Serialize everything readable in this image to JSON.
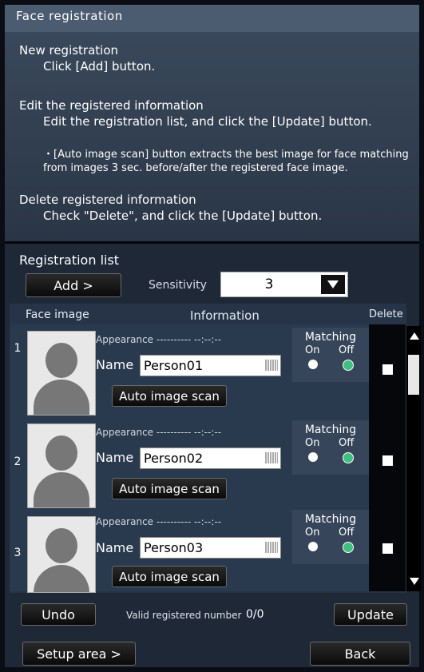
{
  "title": "Face registration",
  "instructions": {
    "new_heading": "New registration",
    "new_text": "Click [Add] button.",
    "edit_heading": "Edit the registered information",
    "edit_text": "Edit the registration list, and click the [Update] button.",
    "note_line1": "・[Auto image scan] button extracts the best image for face matching",
    "note_line2": "from images 3 sec. before/after the registered face image.",
    "delete_heading": "Delete registered information",
    "delete_text": "Check \"Delete\", and click the [Update] button."
  },
  "registration_list": {
    "title": "Registration list",
    "add_label": "Add  >",
    "sensitivity_label": "Sensitivity",
    "sensitivity_value": "3",
    "columns": {
      "face": "Face image",
      "info": "Information",
      "delete": "Delete"
    },
    "rows": [
      {
        "num": "1",
        "appearance": "Appearance ---------- --:--:--",
        "name_label": "Name",
        "name": "Person01",
        "scan_label": "Auto image scan",
        "matching_label": "Matching",
        "on": "On",
        "off": "Off",
        "matching": "off",
        "delete": false
      },
      {
        "num": "2",
        "appearance": "Appearance ---------- --:--:--",
        "name_label": "Name",
        "name": "Person02",
        "scan_label": "Auto image scan",
        "matching_label": "Matching",
        "on": "On",
        "off": "Off",
        "matching": "off",
        "delete": false
      },
      {
        "num": "3",
        "appearance": "Appearance ---------- --:--:--",
        "name_label": "Name",
        "name": "Person03",
        "scan_label": "Auto image scan",
        "matching_label": "Matching",
        "on": "On",
        "off": "Off",
        "matching": "off",
        "delete": false
      }
    ]
  },
  "footer": {
    "undo_label": "Undo",
    "valid_label": "Valid registered number",
    "valid_value": "0/0",
    "update_label": "Update",
    "setup_label": "Setup area  >",
    "back_label": "Back"
  },
  "colors": {
    "panel": "#2a3646",
    "accent_on": "#40c080"
  },
  "icons": {
    "dropdown": "chevron-down-icon",
    "keyboard": "keyboard-icon",
    "face": "person-silhouette-icon"
  }
}
